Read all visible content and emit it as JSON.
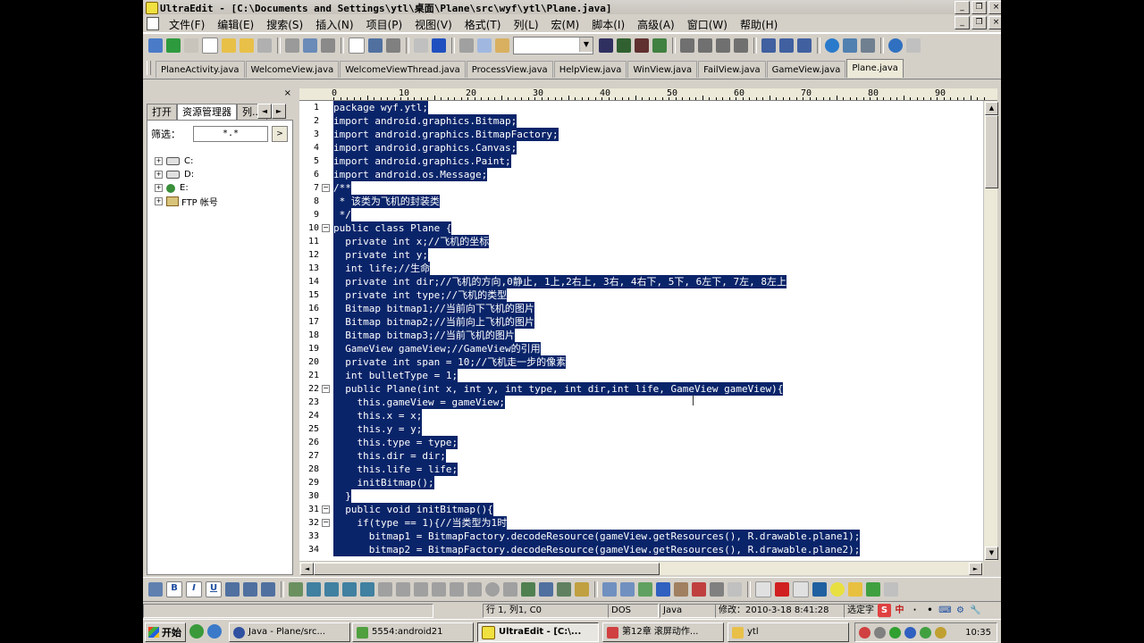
{
  "window": {
    "title": "UltraEdit - [C:\\Documents and Settings\\ytl\\桌面\\Plane\\src\\wyf\\ytl\\Plane.java]",
    "minimize": "_",
    "restore": "❐",
    "close": "×"
  },
  "menu": [
    "文件(F)",
    "编辑(E)",
    "搜索(S)",
    "插入(N)",
    "项目(P)",
    "视图(V)",
    "格式(T)",
    "列(L)",
    "宏(M)",
    "脚本(I)",
    "高级(A)",
    "窗口(W)",
    "帮助(H)"
  ],
  "file_tabs": [
    "PlaneActivity.java",
    "WelcomeView.java",
    "WelcomeViewThread.java",
    "ProcessView.java",
    "HelpView.java",
    "WinView.java",
    "FailView.java",
    "GameView.java",
    "Plane.java"
  ],
  "active_tab": "Plane.java",
  "left_panel": {
    "close": "×",
    "tabs": [
      "打开",
      "资源管理器",
      "列..."
    ],
    "filter_label": "筛选：",
    "filter_value": "*.*",
    "filter_go": ">",
    "drives": [
      "C:",
      "D:",
      "E:",
      "FTP 帐号"
    ]
  },
  "ruler": [
    "0",
    "10",
    "20",
    "30",
    "40",
    "50",
    "60",
    "70",
    "80",
    "90"
  ],
  "code_lines": [
    "package wyf.ytl;",
    "import android.graphics.Bitmap;",
    "import android.graphics.BitmapFactory;",
    "import android.graphics.Canvas;",
    "import android.graphics.Paint;",
    "import android.os.Message;",
    "/**",
    " * 该类为飞机的封装类",
    " */",
    "public class Plane {",
    "  private int x;//飞机的坐标",
    "  private int y;",
    "  int life;//生命",
    "  private int dir;//飞机的方向,0静止, 1上,2右上, 3右, 4右下, 5下, 6左下, 7左, 8左上",
    "  private int type;//飞机的类型",
    "  Bitmap bitmap1;//当前向下飞机的图片",
    "  Bitmap bitmap2;//当前向上飞机的图片",
    "  Bitmap bitmap3;//当前飞机的图片",
    "  GameView gameView;//GameView的引用",
    "  private int span = 10;//飞机走一步的像素",
    "  int bulletType = 1;",
    "  public Plane(int x, int y, int type, int dir,int life, GameView gameView){",
    "    this.gameView = gameView;",
    "    this.x = x;",
    "    this.y = y;",
    "    this.type = type;",
    "    this.dir = dir;",
    "    this.life = life;",
    "    initBitmap();",
    "  }",
    "  public void initBitmap(){",
    "    if(type == 1){//当类型为1时",
    "      bitmap1 = BitmapFactory.decodeResource(gameView.getResources(), R.drawable.plane1);",
    "      bitmap2 = BitmapFactory.decodeResource(gameView.getResources(), R.drawable.plane2);"
  ],
  "fold_lines": [
    7,
    10,
    22,
    31,
    32
  ],
  "status": {
    "position": "行 1, 列1, C0",
    "line_ending": "DOS",
    "syntax": "Java",
    "modified": "修改：2010-3-18 8:41:28",
    "mode": "选定字"
  },
  "ime_icons": [
    "S",
    "中",
    "·",
    "•",
    "⌨",
    "⚙",
    "🔧"
  ],
  "taskbar": {
    "start": "开始",
    "tasks": [
      "Java - Plane/src...",
      "5554:android21",
      "UltraEdit - [C:\\...",
      "第12章 滚屏动作...",
      "ytl"
    ],
    "active_task": "UltraEdit - [C:\\...",
    "time": "10:35"
  },
  "colors": {
    "selection": "#0a246a",
    "chrome": "#d4d0c8"
  }
}
